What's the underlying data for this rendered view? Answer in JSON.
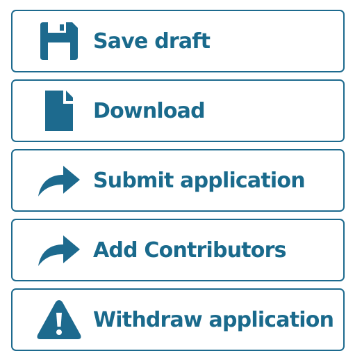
{
  "colors": {
    "accent": "#1d6a8e",
    "text": "#1a6a8c",
    "background": "#ffffff"
  },
  "actions": [
    {
      "label": "Save draft",
      "icon": "save-icon"
    },
    {
      "label": "Download",
      "icon": "document-icon"
    },
    {
      "label": "Submit application",
      "icon": "share-arrow-icon"
    },
    {
      "label": "Add Contributors",
      "icon": "share-arrow-icon"
    },
    {
      "label": "Withdraw application",
      "icon": "warning-icon"
    }
  ]
}
